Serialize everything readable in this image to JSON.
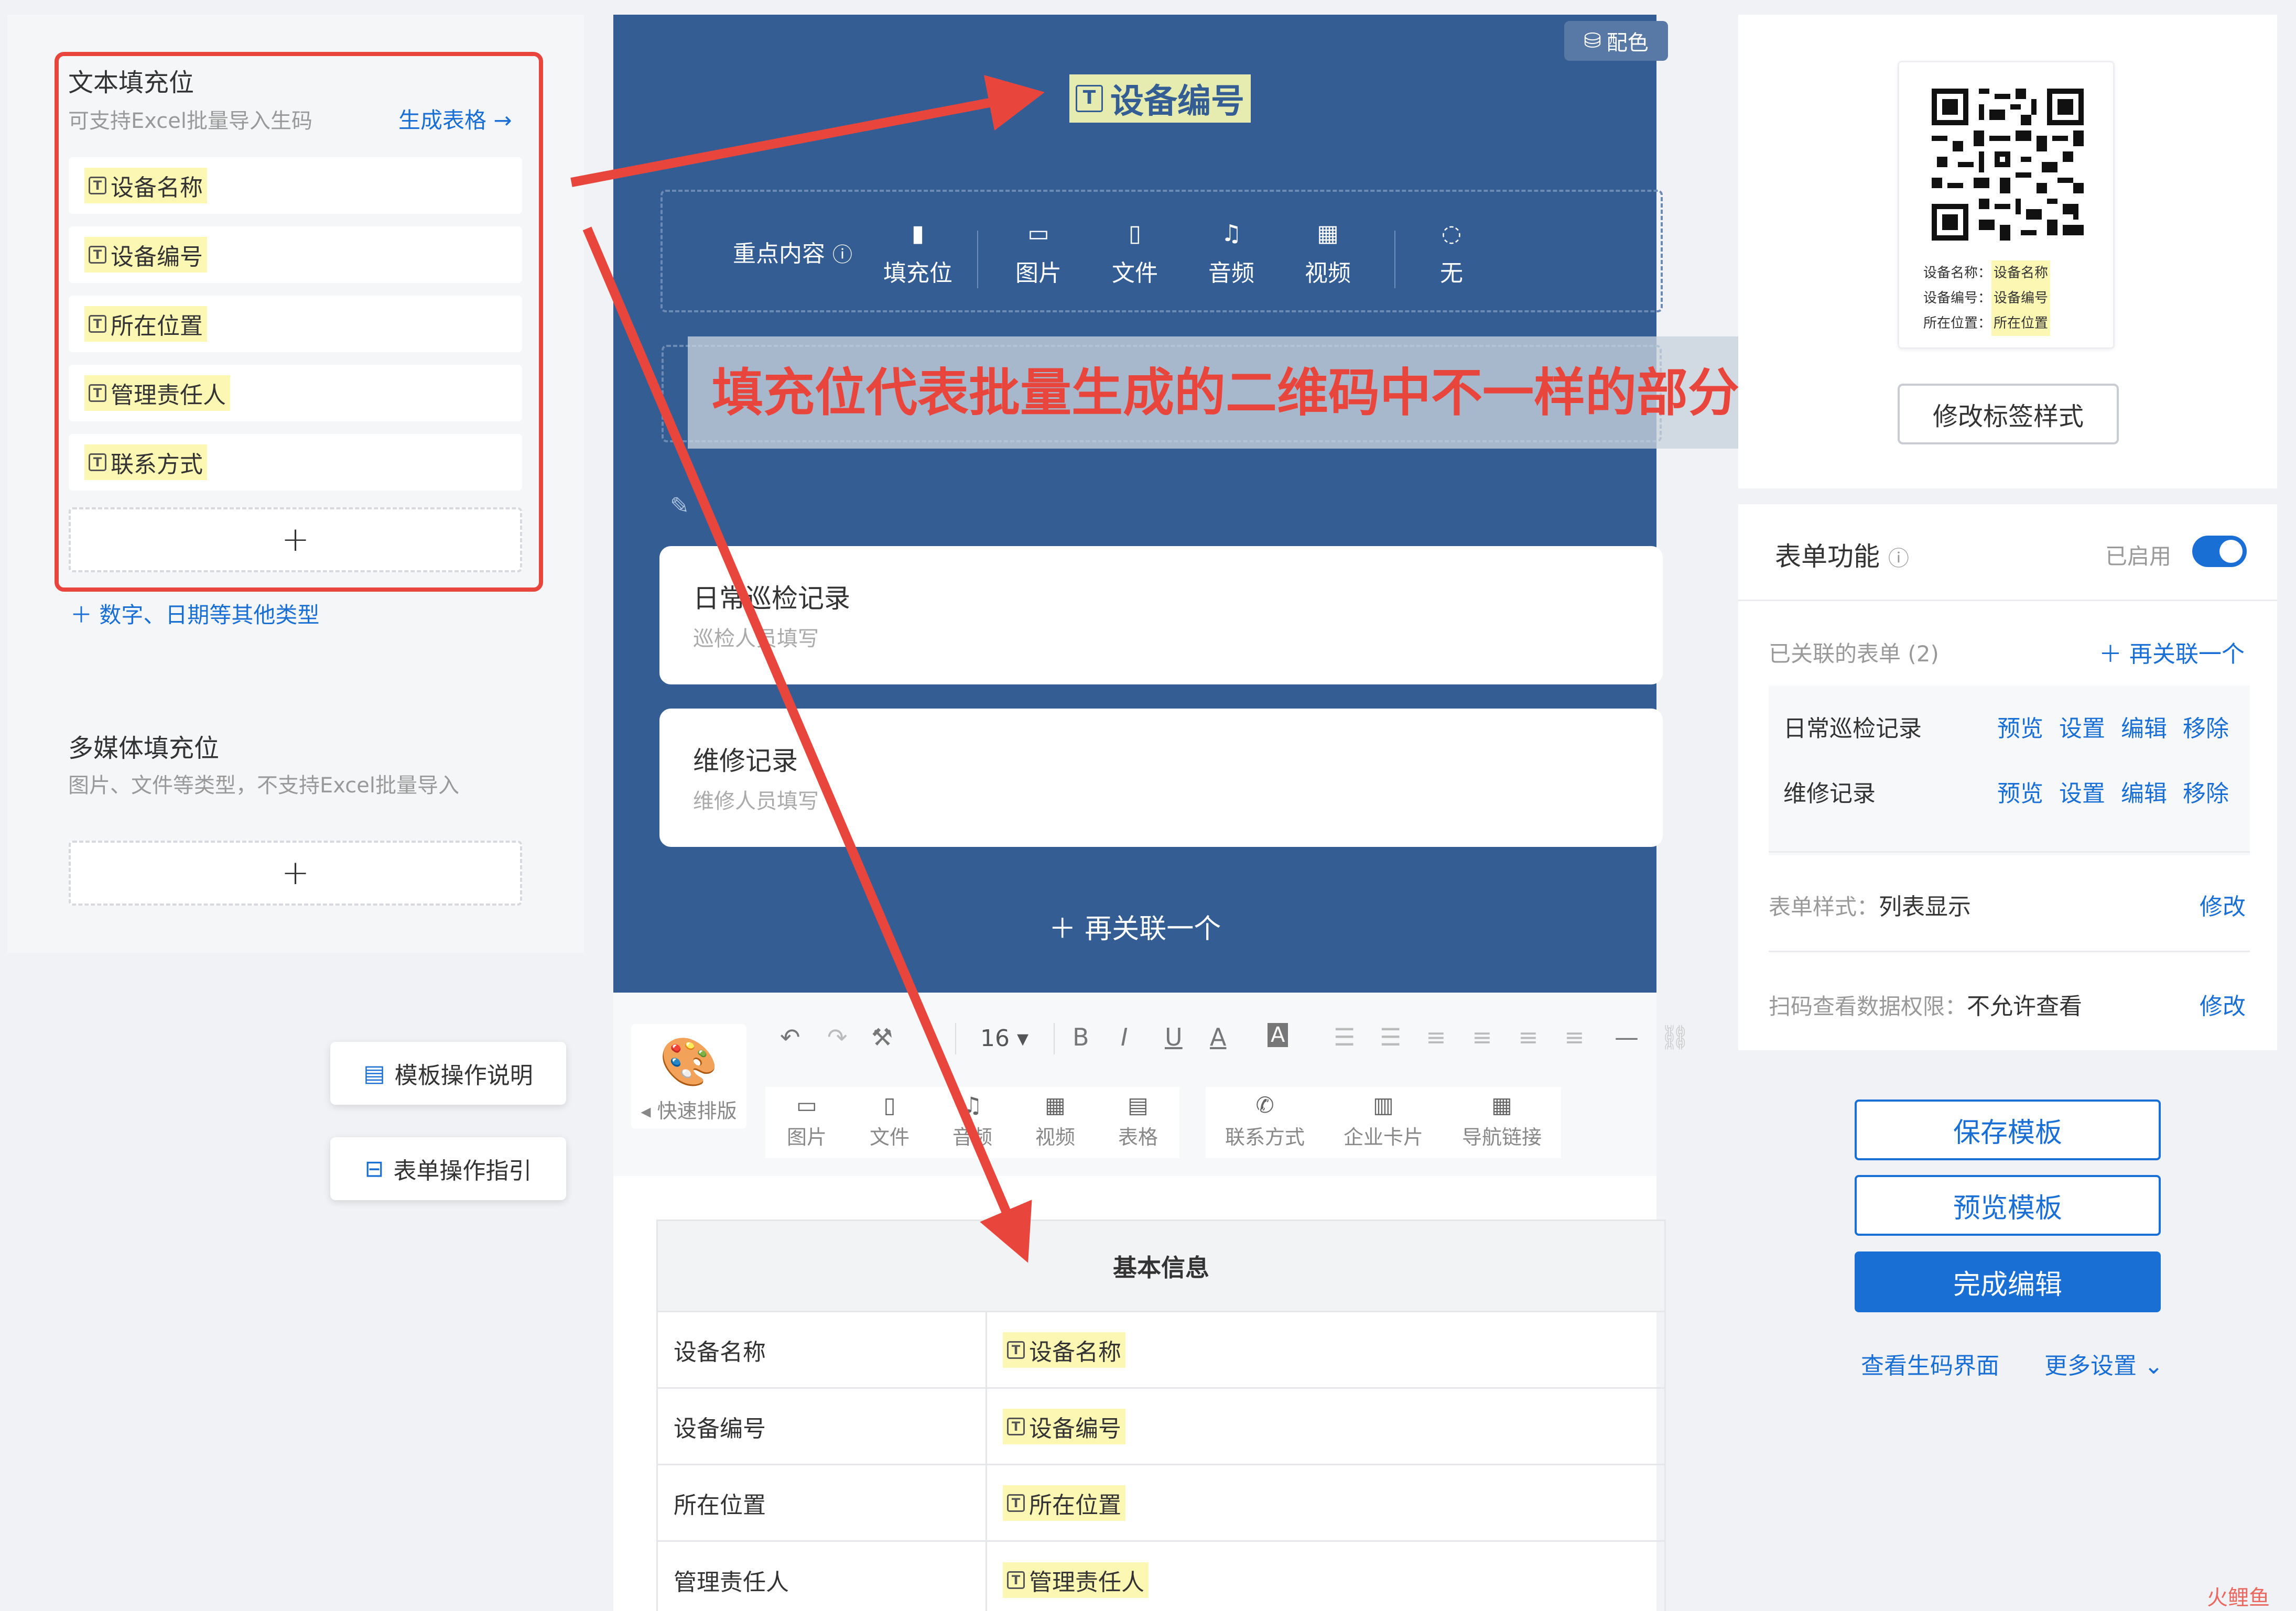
{
  "left": {
    "text_ph_title": "文本填充位",
    "text_ph_sub": "可支持Excel批量导入生码",
    "gen_table": "生成表格 →",
    "items": [
      "设备名称",
      "设备编号",
      "所在位置",
      "管理责任人",
      "联系方式"
    ],
    "add_symbol": "+",
    "more_types": "＋ 数字、日期等其他类型",
    "media_title": "多媒体填充位",
    "media_sub": "图片、文件等类型，不支持Excel批量导入",
    "btn_template_help": "模板操作说明",
    "btn_form_guide": "表单操作指引"
  },
  "center": {
    "color_btn": "配色",
    "title_tag": "设备编号",
    "key_label": "重点内容",
    "key_items": [
      "填充位",
      "图片",
      "文件",
      "音频",
      "视频",
      "无"
    ],
    "key_icons": [
      "▮",
      "▭",
      "▯",
      "♫",
      "▦",
      "◌"
    ],
    "overlay_text": "填充位代表批量生成的二维码中不一样的部分",
    "forms": [
      {
        "title": "日常巡检记录",
        "sub": "巡检人员填写"
      },
      {
        "title": "维修记录",
        "sub": "维修人员填写"
      }
    ],
    "relink": "＋ 再关联一个",
    "toolbar": {
      "font_size": "16",
      "bold": "B",
      "italic": "I",
      "underline": "U",
      "fontcolor": "A",
      "bgcolor": "A",
      "quick_layout": "◂ 快速排版",
      "groupA": [
        "图片",
        "文件",
        "音频",
        "视频",
        "表格"
      ],
      "groupA_icons": [
        "▭",
        "▯",
        "♫",
        "▦",
        "▤"
      ],
      "groupB": [
        "联系方式",
        "企业卡片",
        "导航链接"
      ],
      "groupB_icons": [
        "✆",
        "▥",
        "▦"
      ]
    },
    "table": {
      "header": "基本信息",
      "rows": [
        {
          "label": "设备名称",
          "value": "设备名称"
        },
        {
          "label": "设备编号",
          "value": "设备编号"
        },
        {
          "label": "所在位置",
          "value": "所在位置"
        },
        {
          "label": "管理责任人",
          "value": "管理责任人"
        }
      ]
    }
  },
  "right": {
    "qr_lines": [
      {
        "label": "设备名称：",
        "value": "设备名称"
      },
      {
        "label": "设备编号：",
        "value": "设备编号"
      },
      {
        "label": "所在位置：",
        "value": "所在位置"
      }
    ],
    "modify_label_style": "修改标签样式",
    "form_func": "表单功能",
    "enabled": "已启用",
    "linked_forms": "已关联的表单 (2)",
    "relink_one": "＋ 再关联一个",
    "linked": [
      {
        "name": "日常巡检记录",
        "actions": [
          "预览",
          "设置",
          "编辑",
          "移除"
        ]
      },
      {
        "name": "维修记录",
        "actions": [
          "预览",
          "设置",
          "编辑",
          "移除"
        ]
      }
    ],
    "form_style_label": "表单样式：",
    "form_style_value": "列表显示",
    "modify": "修改",
    "scan_perm_label": "扫码查看数据权限：",
    "scan_perm_value": "不允许查看",
    "save_template": "保存模板",
    "preview_template": "预览模板",
    "finish_edit": "完成编辑",
    "view_gen_page": "查看生码界面",
    "more_settings": "更多设置 ⌄"
  },
  "watermark": "火鲤鱼",
  "colors": {
    "accent": "#1a6fd4",
    "canvas_blue": "#345e93",
    "annotation_red": "#e8463c",
    "placeholder_tag": "#fdf7b4"
  }
}
